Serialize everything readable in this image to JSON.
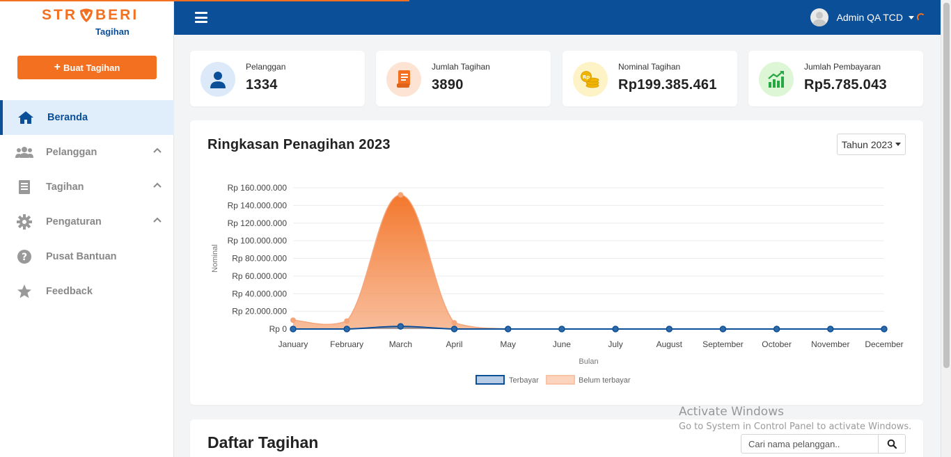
{
  "brand": {
    "logo_left": "STR",
    "logo_right": "BERI",
    "sub": "Tagihan",
    "colors": {
      "primary": "#0b4f98",
      "accent": "#f37021"
    }
  },
  "sidebar": {
    "create_button": "Buat Tagihan",
    "items": [
      {
        "label": "Beranda",
        "icon": "home-icon",
        "active": true
      },
      {
        "label": "Pelanggan",
        "icon": "users-icon",
        "expandable": true
      },
      {
        "label": "Tagihan",
        "icon": "receipt-icon",
        "expandable": true
      },
      {
        "label": "Pengaturan",
        "icon": "gear-icon",
        "expandable": true
      },
      {
        "label": "Pusat Bantuan",
        "icon": "question-icon"
      },
      {
        "label": "Feedback",
        "icon": "star-icon"
      }
    ]
  },
  "topbar": {
    "user_name": "Admin QA TCD"
  },
  "stats": [
    {
      "label": "Pelanggan",
      "value": "1334",
      "icon": "user-icon"
    },
    {
      "label": "Jumlah Tagihan",
      "value": "3890",
      "icon": "invoice-icon"
    },
    {
      "label": "Nominal Tagihan",
      "value": "Rp199.385.461",
      "icon": "coins-icon"
    },
    {
      "label": "Jumlah Pembayaran",
      "value": "Rp5.785.043",
      "icon": "growth-chart-icon"
    }
  ],
  "chart_card": {
    "title": "Ringkasan Penagihan 2023",
    "year_select": "Tahun 2023"
  },
  "chart_data": {
    "type": "area",
    "x": [
      "January",
      "February",
      "March",
      "April",
      "May",
      "June",
      "July",
      "August",
      "September",
      "October",
      "November",
      "December"
    ],
    "series": [
      {
        "name": "Terbayar",
        "values": [
          0,
          0,
          3000000,
          0,
          0,
          0,
          0,
          0,
          0,
          0,
          0,
          0
        ],
        "color": "#0b4f98"
      },
      {
        "name": "Belum terbayar",
        "values": [
          10000000,
          9000000,
          152000000,
          7000000,
          0,
          0,
          0,
          0,
          0,
          0,
          0,
          0
        ],
        "color": "#f37021"
      }
    ],
    "yticks": [
      "Rp 0",
      "Rp 20.000.000",
      "Rp 40.000.000",
      "Rp 60.000.000",
      "Rp 80.000.000",
      "Rp 100.000.000",
      "Rp 120.000.000",
      "Rp 140.000.000",
      "Rp 160.000.000"
    ],
    "ylim": [
      0,
      160000000
    ],
    "xlabel": "Bulan",
    "ylabel": "Nominal",
    "legend_position": "bottom",
    "grid": true
  },
  "list_card": {
    "title": "Daftar Tagihan",
    "search_placeholder": "Cari nama pelanggan.."
  },
  "watermark": {
    "line1": "Activate Windows",
    "line2": "Go to System in Control Panel to activate Windows."
  }
}
